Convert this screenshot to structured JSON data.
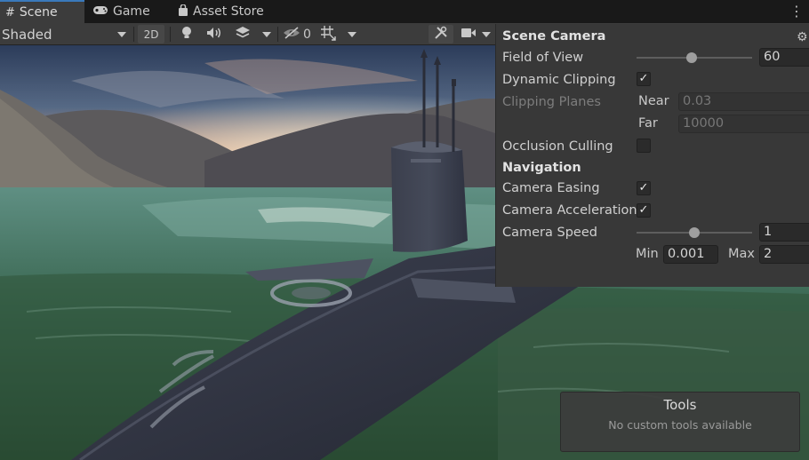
{
  "tabs": [
    {
      "label": "Scene",
      "icon": "hash-grid-icon",
      "active": true
    },
    {
      "label": "Game",
      "icon": "gamepad-icon",
      "active": false
    },
    {
      "label": "Asset Store",
      "icon": "shopping-bag-icon",
      "active": false
    }
  ],
  "toolbar": {
    "shading_mode": "Shaded",
    "mode_2d_label": "2D",
    "hidden_objects_count": "0"
  },
  "scene_camera": {
    "title": "Scene Camera",
    "field_of_view": {
      "label": "Field of View",
      "value": "60",
      "slider_fraction": 0.48
    },
    "dynamic_clipping": {
      "label": "Dynamic Clipping",
      "checked": true,
      "mark": "✓"
    },
    "clipping_planes": {
      "label": "Clipping Planes",
      "near_label": "Near",
      "near_value": "0.03",
      "far_label": "Far",
      "far_value": "10000"
    },
    "occlusion_culling": {
      "label": "Occlusion Culling",
      "checked": false
    },
    "navigation": {
      "title": "Navigation",
      "camera_easing": {
        "label": "Camera Easing",
        "checked": true,
        "mark": "✓"
      },
      "camera_acceleration": {
        "label": "Camera Acceleration",
        "checked": true,
        "mark": "✓"
      },
      "camera_speed": {
        "label": "Camera Speed",
        "value": "1",
        "slider_fraction": 0.5,
        "min_label": "Min",
        "min_value": "0.001",
        "max_label": "Max",
        "max_value": "2"
      }
    }
  },
  "tools_overlay": {
    "title": "Tools",
    "message": "No custom tools available"
  },
  "colors": {
    "tab_accent": "#3a79bb",
    "panel_bg": "#383838",
    "toolbar_bg": "#3c3c3c"
  }
}
